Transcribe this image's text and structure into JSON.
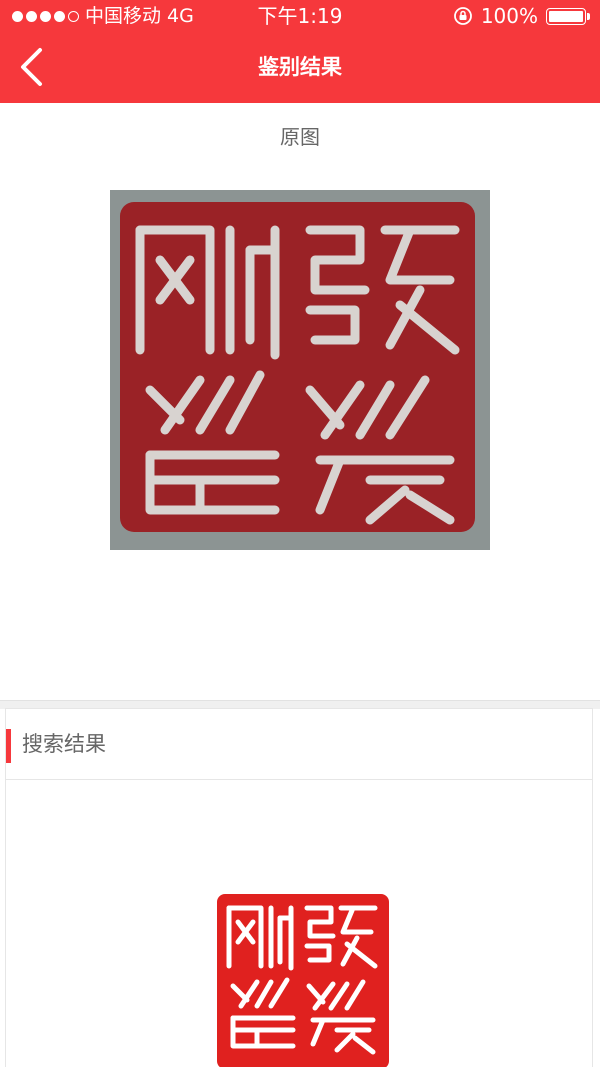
{
  "status_bar": {
    "carrier": "中国移动",
    "network": "4G",
    "time": "下午1:19",
    "battery_percent": "100%",
    "battery_level": 1.0,
    "signal_bars_filled": 4,
    "signal_bars_total": 5
  },
  "nav": {
    "title": "鉴别结果"
  },
  "original": {
    "label": "原图"
  },
  "search_result": {
    "title": "搜索结果"
  },
  "colors": {
    "brand_red": "#f6383c",
    "seal_red_original": "#9a2226",
    "seal_red_result": "#e0211f",
    "seal_background_original": "#8c9493"
  }
}
